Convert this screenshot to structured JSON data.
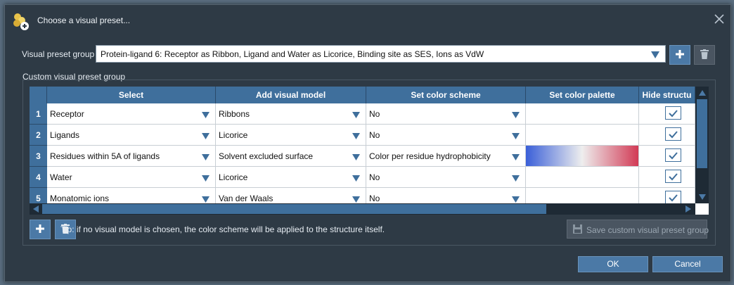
{
  "window": {
    "title": "Choose a visual preset...",
    "icons": {
      "app": "molecule-add-icon",
      "close": "close-icon"
    }
  },
  "visual_preset_group": {
    "label": "Visual preset group",
    "value": "Protein-ligand 6: Receptor as Ribbon, Ligand and Water as Licorice, Binding site as SES, Ions as VdW",
    "icons": {
      "dropdown": "chevron-down-icon",
      "add": "plus-icon",
      "delete": "trash-icon"
    }
  },
  "custom_group": {
    "label": "Custom visual preset group",
    "columns": [
      "Select",
      "Add visual model",
      "Set color scheme",
      "Set color palette",
      "Hide structu"
    ],
    "rows": [
      {
        "num": "1",
        "select": "Receptor",
        "visual_model": "Ribbons",
        "color_scheme": "No",
        "palette": "",
        "hide": true
      },
      {
        "num": "2",
        "select": "Ligands",
        "visual_model": "Licorice",
        "color_scheme": "No",
        "palette": "",
        "hide": true
      },
      {
        "num": "3",
        "select": "Residues within 5A of ligands",
        "visual_model": "Solvent excluded surface",
        "color_scheme": "Color per residue hydrophobicity",
        "palette": "blue-white-red gradient",
        "hide": true
      },
      {
        "num": "4",
        "select": "Water",
        "visual_model": "Licorice",
        "color_scheme": "No",
        "palette": "",
        "hide": true
      },
      {
        "num": "5",
        "select": "Monatomic ions",
        "visual_model": "Van der Waals",
        "color_scheme": "No",
        "palette": "",
        "hide": true
      }
    ],
    "palette_colors": [
      "#3a5fd8",
      "#eeeeee",
      "#d23a55"
    ]
  },
  "tip": "Tip: if no visual model is chosen, the color scheme will be applied to the structure itself.",
  "buttons": {
    "save": "Save custom visual preset group",
    "ok": "OK",
    "cancel": "Cancel"
  },
  "colors": {
    "accent": "#4b79a6",
    "header": "#3f6f9c",
    "background": "#2e3a45"
  }
}
